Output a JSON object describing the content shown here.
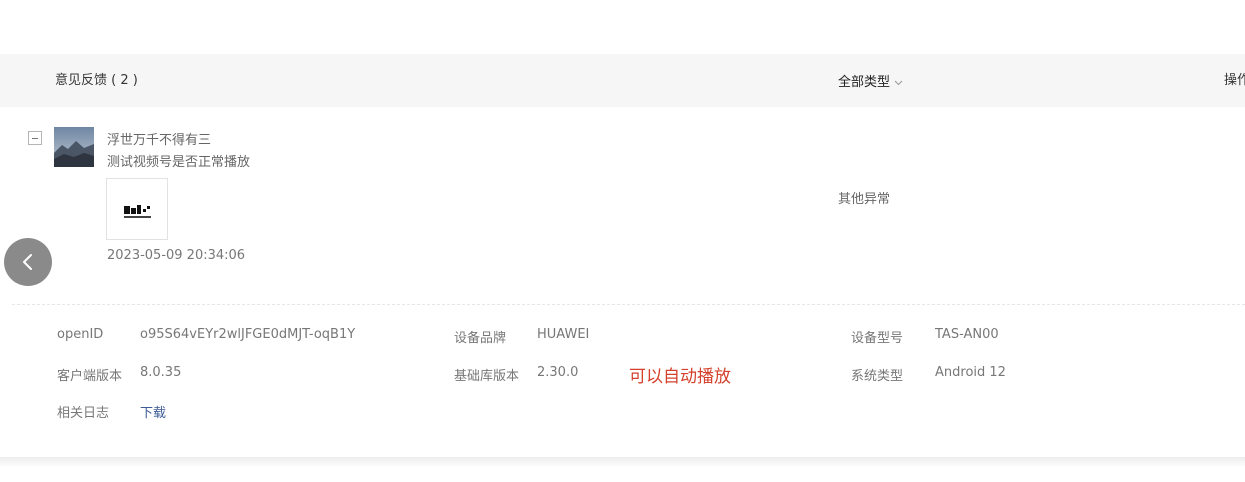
{
  "header": {
    "title": "意见反馈 ( 2 )",
    "type_filter_label": "全部类型",
    "operation_label": "操作"
  },
  "feedback": {
    "user_name": "浮世万千不得有三",
    "content": "测试视频号是否正常播放",
    "time": "2023-05-09 20:34:06",
    "category": "其他异常"
  },
  "details": {
    "openid_label": "openID",
    "openid_value": "o95S64vEYr2wlJFGE0dMJT-oqB1Y",
    "brand_label": "设备品牌",
    "brand_value": "HUAWEI",
    "model_label": "设备型号",
    "model_value": "TAS-AN00",
    "client_version_label": "客户端版本",
    "client_version_value": "8.0.35",
    "base_lib_label": "基础库版本",
    "base_lib_value": "2.30.0",
    "annotation": "可以自动播放",
    "os_label": "系统类型",
    "os_value": "Android 12",
    "log_label": "相关日志",
    "log_link": "下载"
  },
  "colors": {
    "header_bg": "#f6f6f7",
    "link": "#3d5b96",
    "annotation": "#d4402b",
    "back_button": "#8a8a8a"
  },
  "icons": {
    "back": "chevron-left-icon",
    "collapse": "minus-square-icon",
    "filter": "chevron-down-icon"
  }
}
